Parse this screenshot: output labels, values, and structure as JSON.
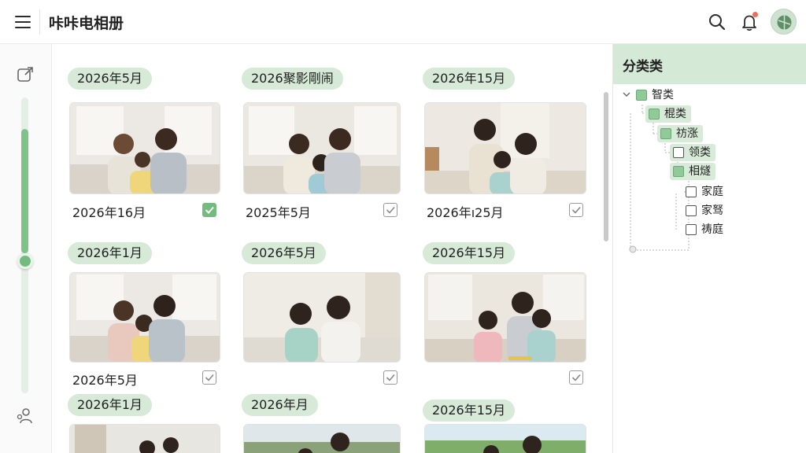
{
  "app": {
    "title": "咔咔电相册"
  },
  "rail": {
    "zoom_level": 0.56
  },
  "groups": [
    {
      "date": "2026年5月",
      "caption": "2026年16月",
      "checked": true
    },
    {
      "date": "2026聚影剛闹",
      "caption": "2025年5月",
      "checked": false
    },
    {
      "date": "2026年15月",
      "caption": "2026年ı25月",
      "checked": false
    },
    {
      "date": "2026年1月",
      "caption": "2026年5月",
      "checked": false
    },
    {
      "date": "2026年5月",
      "caption": "",
      "checked": false
    },
    {
      "date": "2026年15月",
      "caption": "",
      "checked": false
    },
    {
      "date": "2026年1月",
      "caption": "",
      "checked": false
    },
    {
      "date": "2026年月",
      "caption": "",
      "checked": false
    },
    {
      "date": "2026年15月",
      "caption": "",
      "checked": false
    }
  ],
  "panel": {
    "title": "分类类",
    "tree": [
      {
        "label": "智类",
        "box": "green"
      },
      {
        "label": "棍类",
        "box": "green"
      },
      {
        "label": "祊涨",
        "box": "green"
      },
      {
        "label": "领类",
        "box": "empty"
      },
      {
        "label": "相燧",
        "box": "green"
      },
      {
        "label": "家庭",
        "box": "empty"
      },
      {
        "label": "家驽",
        "box": "empty"
      },
      {
        "label": "祷庭",
        "box": "empty"
      }
    ]
  },
  "colors": {
    "accent": "#74bb7f",
    "accent_light": "#d6ead7"
  }
}
